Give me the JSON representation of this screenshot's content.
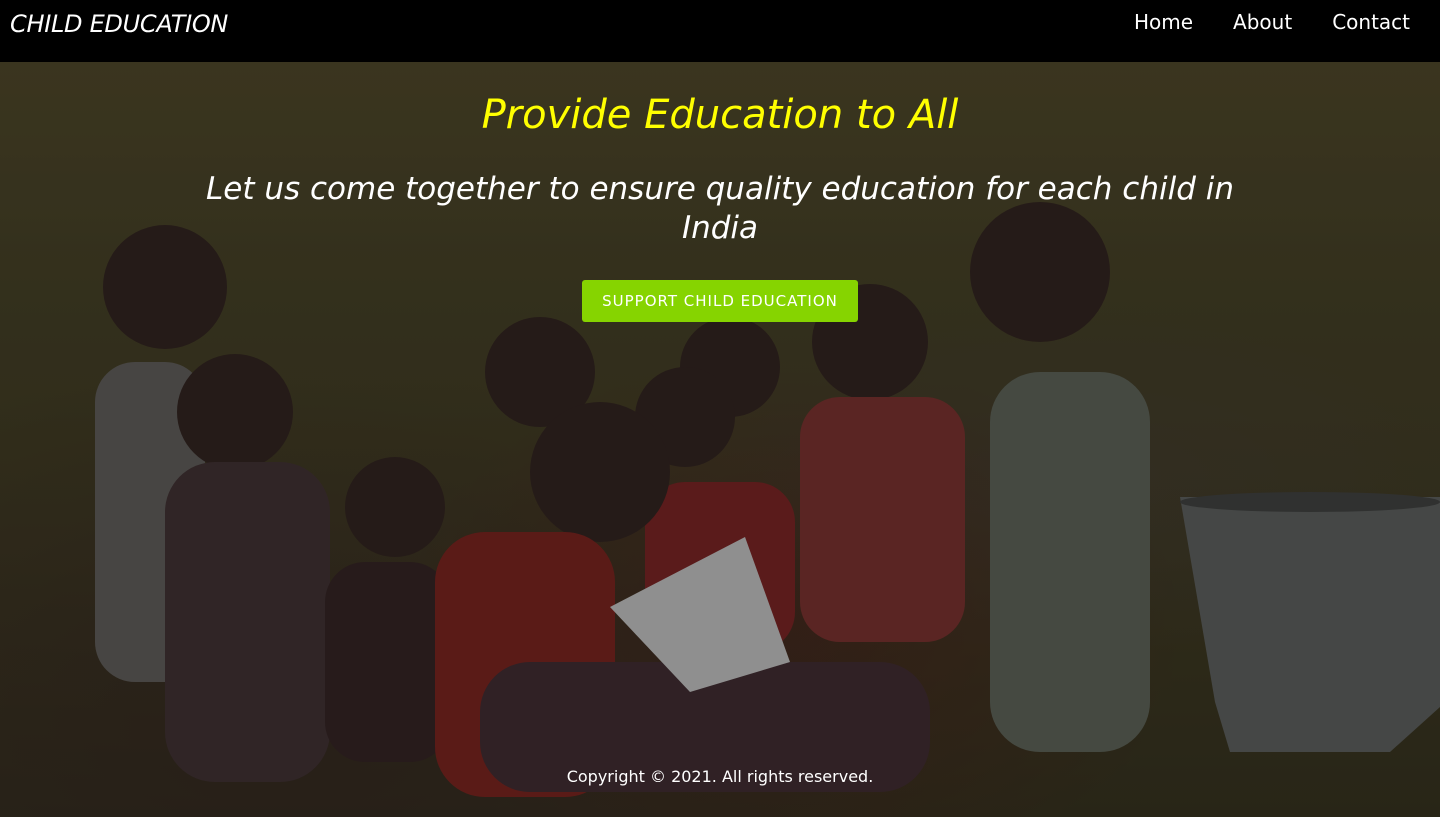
{
  "navbar": {
    "brand": "CHILD EDUCATION",
    "links": [
      "Home",
      "About",
      "Contact"
    ]
  },
  "hero": {
    "headline": "Provide Education to All",
    "subheadline": "Let us come together to ensure quality education for each child in India",
    "cta_label": "SUPPORT CHILD EDUCATION",
    "background_image": "children sitting on grass studying together"
  },
  "footer": {
    "copyright": "Copyright © 2021. All rights reserved."
  },
  "colors": {
    "navbar_bg": "#000000",
    "headline": "#ffff00",
    "cta_bg": "#86d400",
    "text": "#ffffff"
  }
}
